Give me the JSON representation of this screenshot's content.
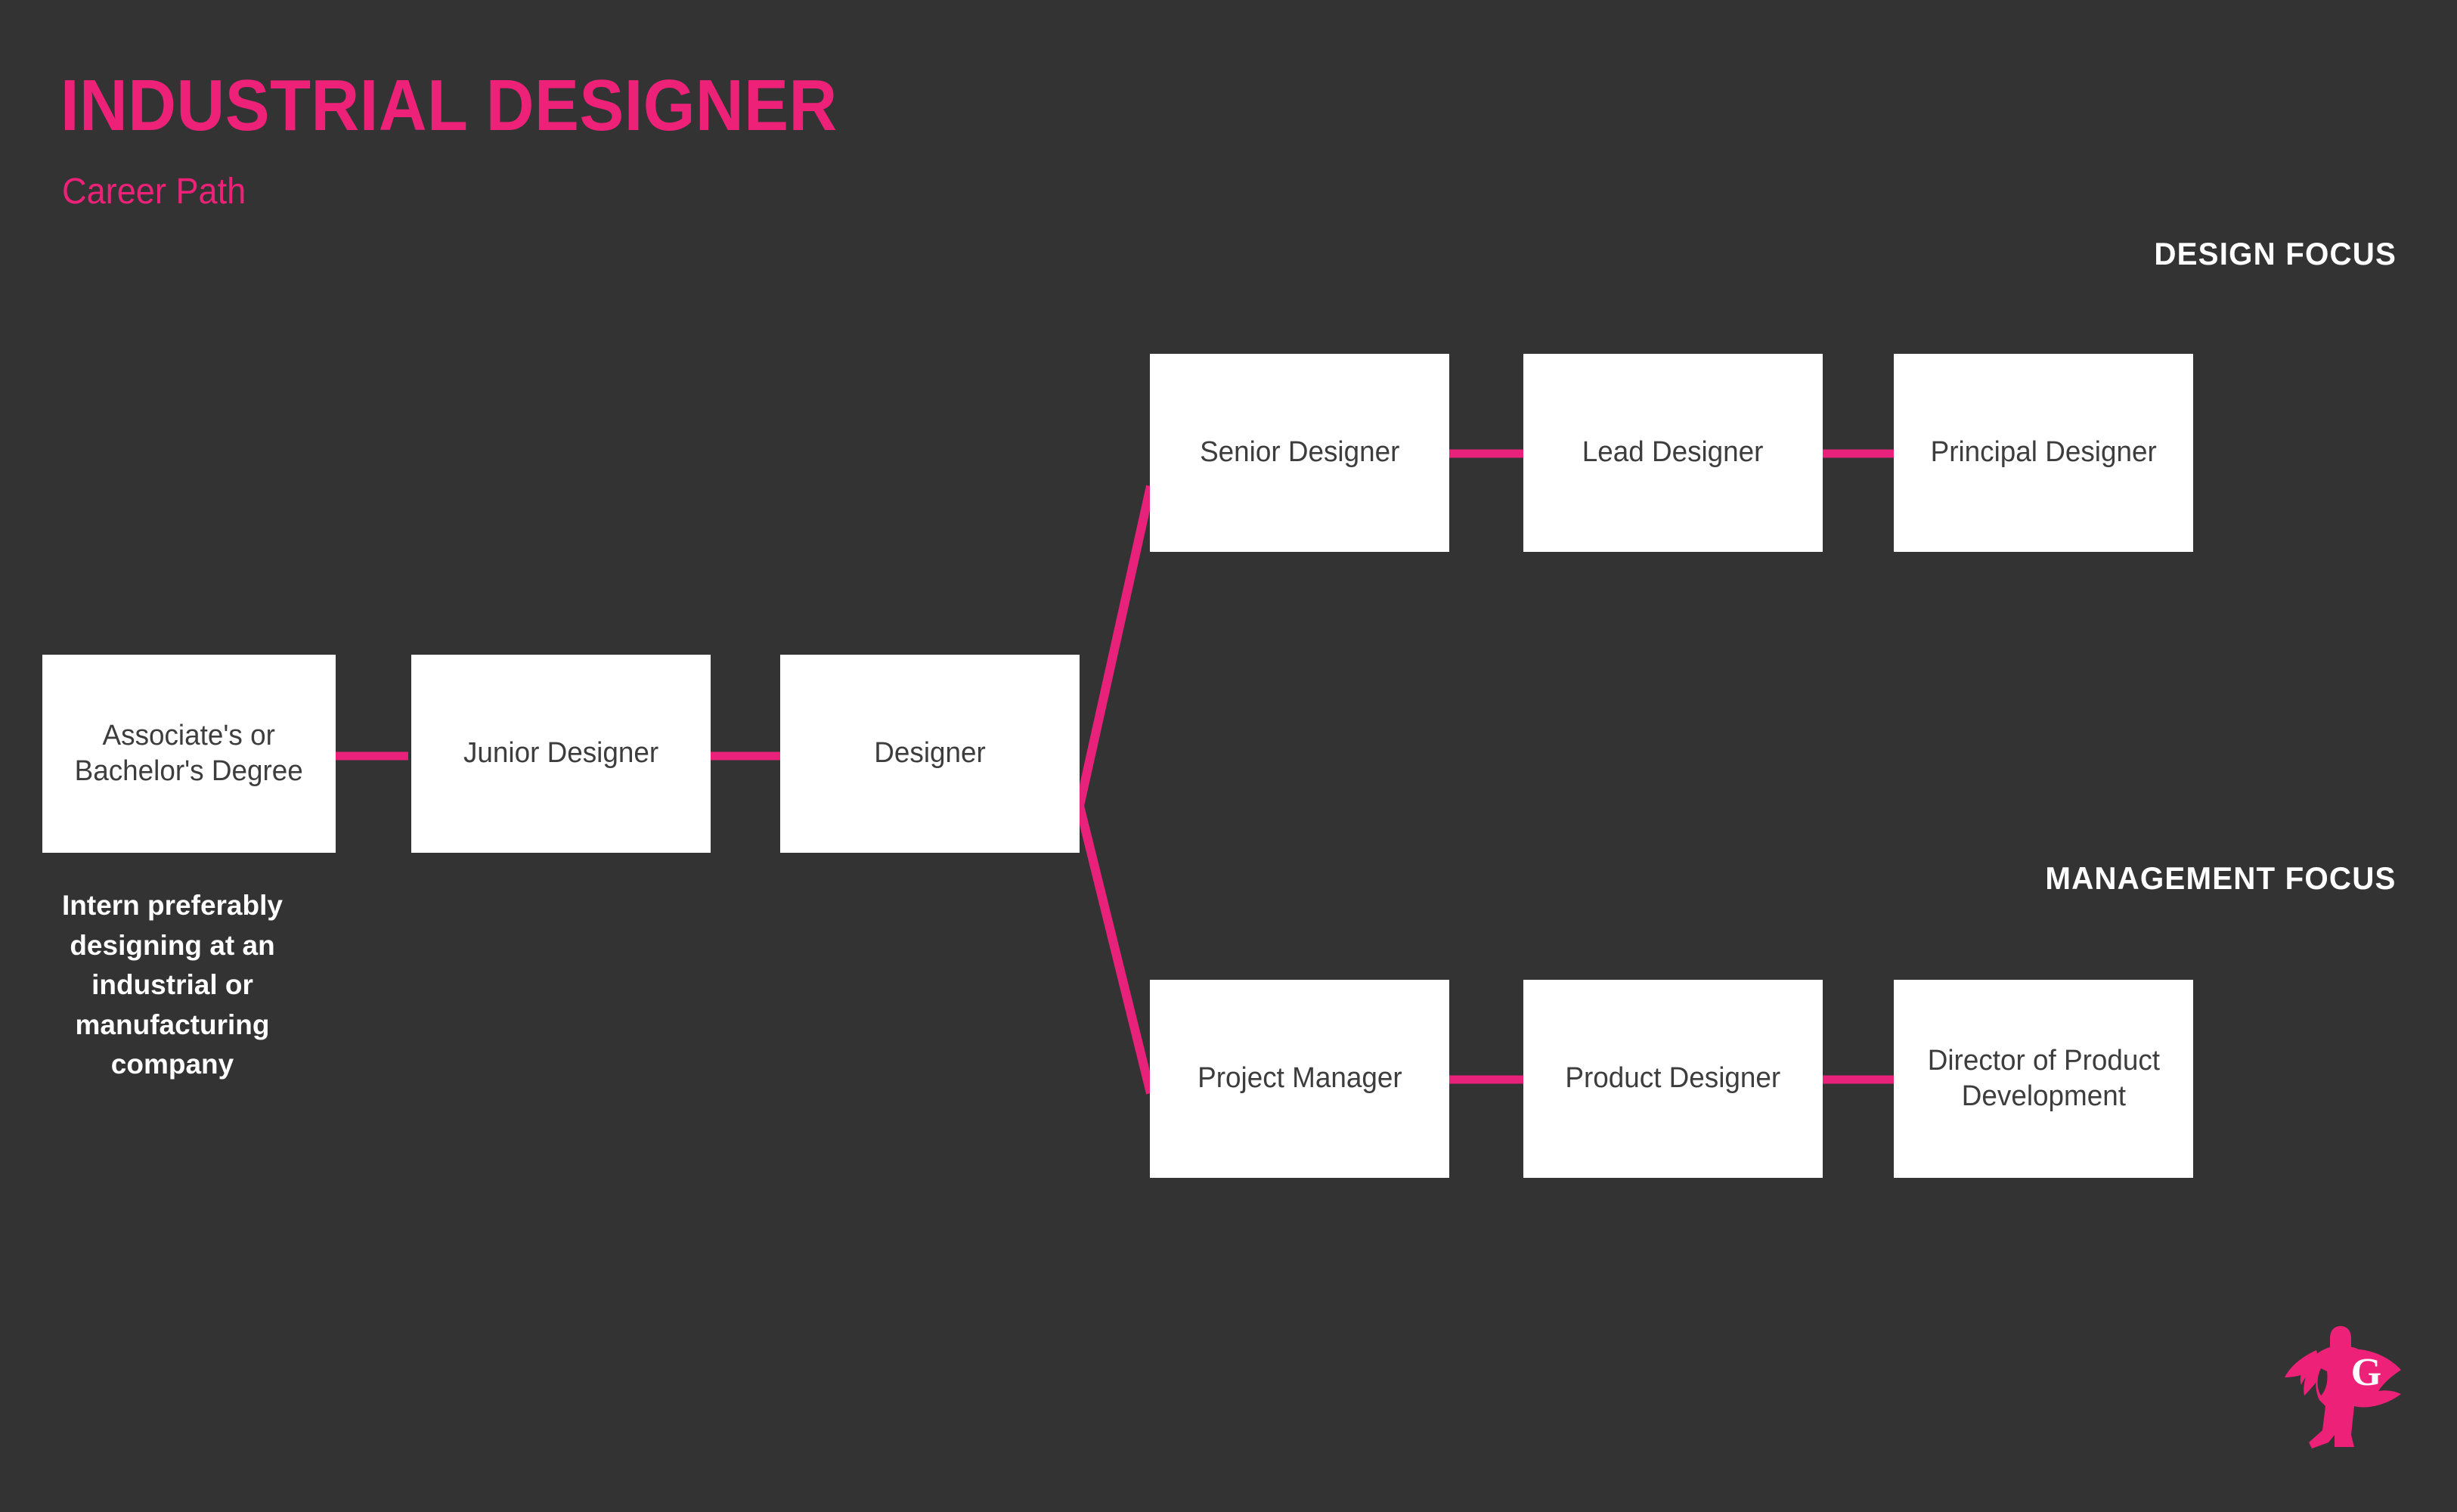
{
  "header": {
    "title": "INDUSTRIAL DESIGNER",
    "subtitle": "Career Path",
    "design_focus_label": "DESIGN FOCUS",
    "management_focus_label": "MANAGEMENT FOCUS"
  },
  "colors": {
    "background": "#333333",
    "accent_pink": "#ee2178",
    "connector_pink": "#e8217a",
    "box_fill": "#ffffff",
    "box_text": "#3d3d3d",
    "label_white": "#ffffff"
  },
  "nodes": {
    "degree": {
      "label": "Associate's or\nBachelor's Degree"
    },
    "junior_designer": {
      "label": "Junior Designer"
    },
    "designer": {
      "label": "Designer"
    },
    "senior_designer": {
      "label": "Senior Designer"
    },
    "lead_designer": {
      "label": "Lead Designer"
    },
    "principal_designer": {
      "label": "Principal Designer"
    },
    "project_manager": {
      "label": "Project Manager"
    },
    "product_designer": {
      "label": "Product Designer"
    },
    "director_product_development": {
      "label": "Director of Product\nDevelopment"
    }
  },
  "notes": {
    "intern": "Intern preferably\ndesigning at an\nindustrial or\nmanufacturing\ncompany"
  },
  "logo": {
    "letter": "G",
    "name": "superhero-g-logo"
  },
  "chart_data": {
    "type": "diagram",
    "title": "INDUSTRIAL DESIGNER Career Path",
    "branches": [
      {
        "name": "DESIGN FOCUS",
        "steps": [
          "Senior Designer",
          "Lead Designer",
          "Principal Designer"
        ]
      },
      {
        "name": "MANAGEMENT FOCUS",
        "steps": [
          "Project Manager",
          "Product Designer",
          "Director of Product Development"
        ]
      }
    ],
    "trunk": [
      "Associate's or Bachelor's Degree",
      "Junior Designer",
      "Designer"
    ],
    "edges": [
      {
        "from": "Associate's or Bachelor's Degree",
        "to": "Junior Designer",
        "style": "straight"
      },
      {
        "from": "Junior Designer",
        "to": "Designer",
        "style": "straight"
      },
      {
        "from": "Designer",
        "to": "Senior Designer",
        "style": "diagonal-up"
      },
      {
        "from": "Senior Designer",
        "to": "Lead Designer",
        "style": "straight"
      },
      {
        "from": "Lead Designer",
        "to": "Principal Designer",
        "style": "straight"
      },
      {
        "from": "Designer",
        "to": "Project Manager",
        "style": "diagonal-down"
      },
      {
        "from": "Project Manager",
        "to": "Product Designer",
        "style": "straight"
      },
      {
        "from": "Product Designer",
        "to": "Director of Product Development",
        "style": "straight"
      }
    ]
  }
}
